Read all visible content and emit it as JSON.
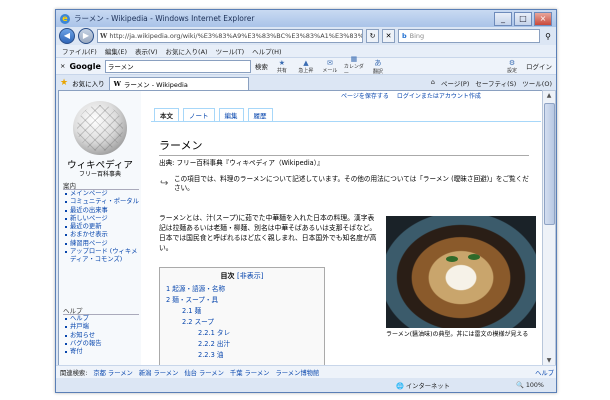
{
  "window": {
    "title": "ラーメン - Wikipedia - Windows Internet Explorer",
    "min": "_",
    "max": "□",
    "close": "×"
  },
  "address": {
    "url": "http://ja.wikipedia.org/wiki/%E3%83%A9%E3%83%BC%E3%83%A1%E3%83%B3",
    "search_placeholder": "Bing",
    "search_brand": "b"
  },
  "menu": [
    "ファイル(F)",
    "編集(E)",
    "表示(V)",
    "お気に入り(A)",
    "ツール(T)",
    "ヘルプ(H)"
  ],
  "google": {
    "logo": "Google",
    "query": "ラーメン",
    "search_btn": "検索",
    "login": "ログイン",
    "icons": [
      "共有",
      "急上昇",
      "メール",
      "カレンダー",
      "翻訳",
      "設定"
    ]
  },
  "favorites": {
    "label": "お気に入り",
    "tab": "ラーメン - Wikipedia",
    "cmd": [
      "ページ(P)",
      "セーフティ(S)",
      "ツール(O)"
    ]
  },
  "wiki": {
    "name": "ウィキペディア",
    "sub": "フリー百科事典",
    "toplinks": [
      "ページを保存する",
      "ログインまたはアカウント作成"
    ],
    "tabs": [
      "本文",
      "ノート",
      "編集",
      "履歴"
    ],
    "portal1": "案内",
    "nav": [
      "メインページ",
      "コミュニティ・ポータル",
      "最近の出来事",
      "新しいページ",
      "最近の更新",
      "おまかせ表示",
      "練習用ページ",
      "アップロード (ウィキメディア・コモンズ)"
    ],
    "portal2": "ヘルプ",
    "help": [
      "ヘルプ",
      "井戸端",
      "お知らせ",
      "バグの報告",
      "寄付"
    ],
    "title": "ラーメン",
    "from": "出典: フリー百科事典『ウィキペディア（Wikipedia）』",
    "note": "この項目では、料理のラーメンについて記述しています。その他の用法については「ラーメン (曖昧さ回避)」をご覧ください。",
    "lead": "ラーメンとは、汁(スープ)に茹でた中華麺を入れた日本の料理。漢字表記は拉麺あるいは老麺・柳麺、別名は中華そばあるいは支那そばなど。日本では国民食と呼ばれるほど広く親しまれ、日本国外でも知名度が高い。",
    "toc_title": "目次",
    "toc_toggle": "[非表示]",
    "toc": [
      "1 起源・語源・名称",
      "2 麺・スープ・具",
      "2.1 麺",
      "2.2 スープ",
      "2.2.1 タレ",
      "2.2.2 出汁",
      "2.2.3 油"
    ],
    "caption": "ラーメン(醤油味)の典型。丼には雷文の模様が見える"
  },
  "bottombar": {
    "label": "関連検索:",
    "links": [
      "京都 ラーメン",
      "新潟 ラーメン",
      "仙台 ラーメン",
      "千葉 ラーメン",
      "ラーメン博物館"
    ],
    "help": "ヘルプ"
  },
  "status": {
    "zone": "インターネット",
    "zoom": "100%"
  }
}
